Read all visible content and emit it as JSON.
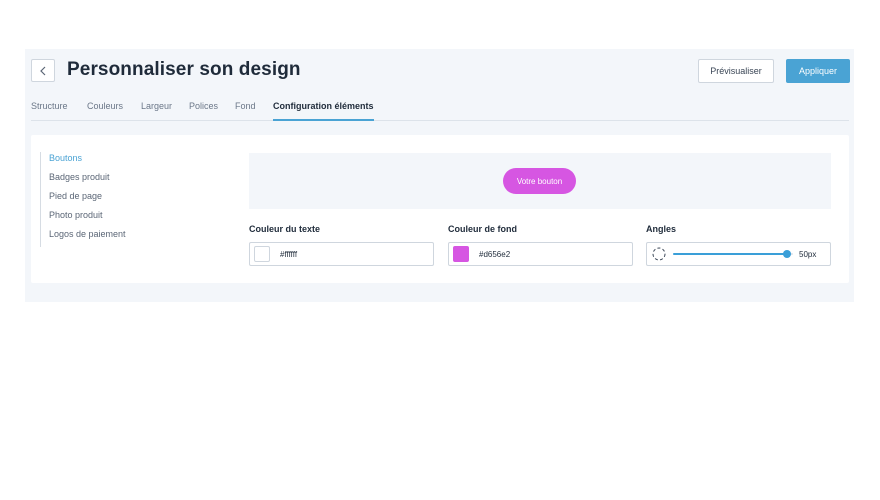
{
  "header": {
    "title": "Personnaliser son design",
    "preview_label": "Prévisualiser",
    "apply_label": "Appliquer"
  },
  "tabs": [
    {
      "label": "Structure",
      "active": false
    },
    {
      "label": "Couleurs",
      "active": false
    },
    {
      "label": "Largeur",
      "active": false
    },
    {
      "label": "Polices",
      "active": false
    },
    {
      "label": "Fond",
      "active": false
    },
    {
      "label": "Configuration éléments",
      "active": true
    }
  ],
  "sidemenu": {
    "items": [
      {
        "label": "Boutons",
        "active": true
      },
      {
        "label": "Badges produit",
        "active": false
      },
      {
        "label": "Pied de page",
        "active": false
      },
      {
        "label": "Photo produit",
        "active": false
      },
      {
        "label": "Logos de paiement",
        "active": false
      }
    ]
  },
  "preview": {
    "button_label": "Votre bouton"
  },
  "fields": {
    "text_color": {
      "label": "Couleur du texte",
      "value": "#ffffff"
    },
    "bg_color": {
      "label": "Couleur de fond",
      "value": "#d656e2"
    },
    "angles": {
      "label": "Angles",
      "value": "50px",
      "fraction": 0.95
    }
  },
  "colors": {
    "accent": "#4aa3d4",
    "button_bg": "#d656e2",
    "button_text": "#ffffff"
  },
  "icons": {
    "back": "chevron-left-icon",
    "corner": "rounded-corner-icon"
  }
}
